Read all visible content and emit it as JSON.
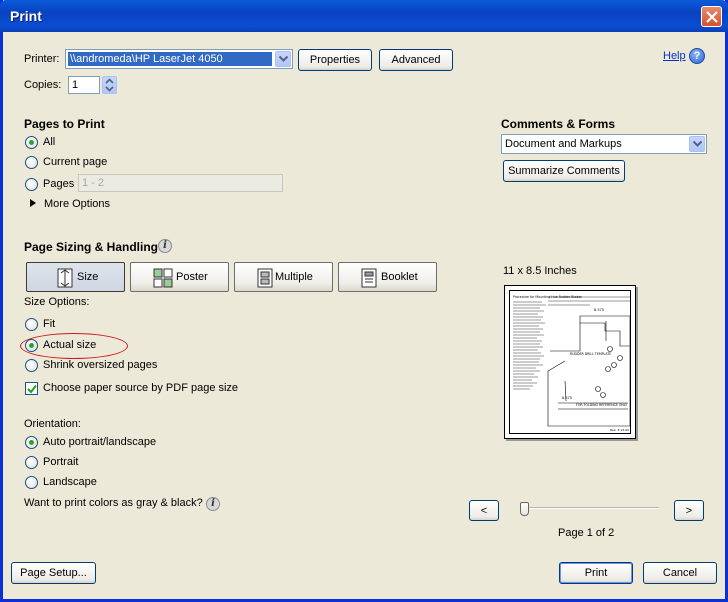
{
  "window": {
    "title": "Print"
  },
  "printer": {
    "label": "Printer:",
    "selected": "\\\\andromeda\\HP LaserJet 4050",
    "properties_label": "Properties",
    "advanced_label": "Advanced",
    "help_label": "Help"
  },
  "copies": {
    "label": "Copies:",
    "value": "1"
  },
  "pages_to_print": {
    "title": "Pages to Print",
    "all_label": "All",
    "current_label": "Current page",
    "pages_label": "Pages",
    "pages_value": "1 - 2",
    "more_options_label": "More Options",
    "selected": "All"
  },
  "comments_forms": {
    "title": "Comments & Forms",
    "selected": "Document and Markups",
    "summarize_label": "Summarize Comments"
  },
  "page_sizing": {
    "title": "Page Sizing & Handling",
    "buttons": [
      {
        "label": "Size"
      },
      {
        "label": "Poster"
      },
      {
        "label": "Multiple"
      },
      {
        "label": "Booklet"
      }
    ],
    "active": "Size",
    "size_options_label": "Size Options:",
    "fit_label": "Fit",
    "actual_label": "Actual size",
    "shrink_label": "Shrink oversized pages",
    "size_selected": "Actual size",
    "paper_source_label": "Choose paper source by PDF page size",
    "paper_source_checked": true
  },
  "orientation": {
    "title": "Orientation:",
    "auto_label": "Auto portrait/landscape",
    "portrait_label": "Portrait",
    "landscape_label": "Landscape",
    "selected": "Auto portrait/landscape"
  },
  "gray_label": "Want to print colors as gray & black?",
  "preview": {
    "size_label": "11 x 8.5 Inches",
    "prev_label": "<",
    "next_label": ">",
    "page_indicator": "Page 1 of 2",
    "slider_position": 0.0,
    "doc_title": "Procedure for Mounting Hue Rudder Blades",
    "template_label": "RUDDER DRILL TEMPLATE",
    "fold_label": "FOR FOLDING REFERENCE ONLY",
    "dim_top": "8.375",
    "dim_bottom": "6.375",
    "rev_label": "Rev: 3-13-00"
  },
  "footer": {
    "page_setup_label": "Page Setup...",
    "print_label": "Print",
    "cancel_label": "Cancel"
  },
  "colors": {
    "title_bar": "#0a4fd0",
    "dialog_bg": "#ece9d8",
    "selection": "#316ac5",
    "annotation": "#cc1b1b"
  }
}
